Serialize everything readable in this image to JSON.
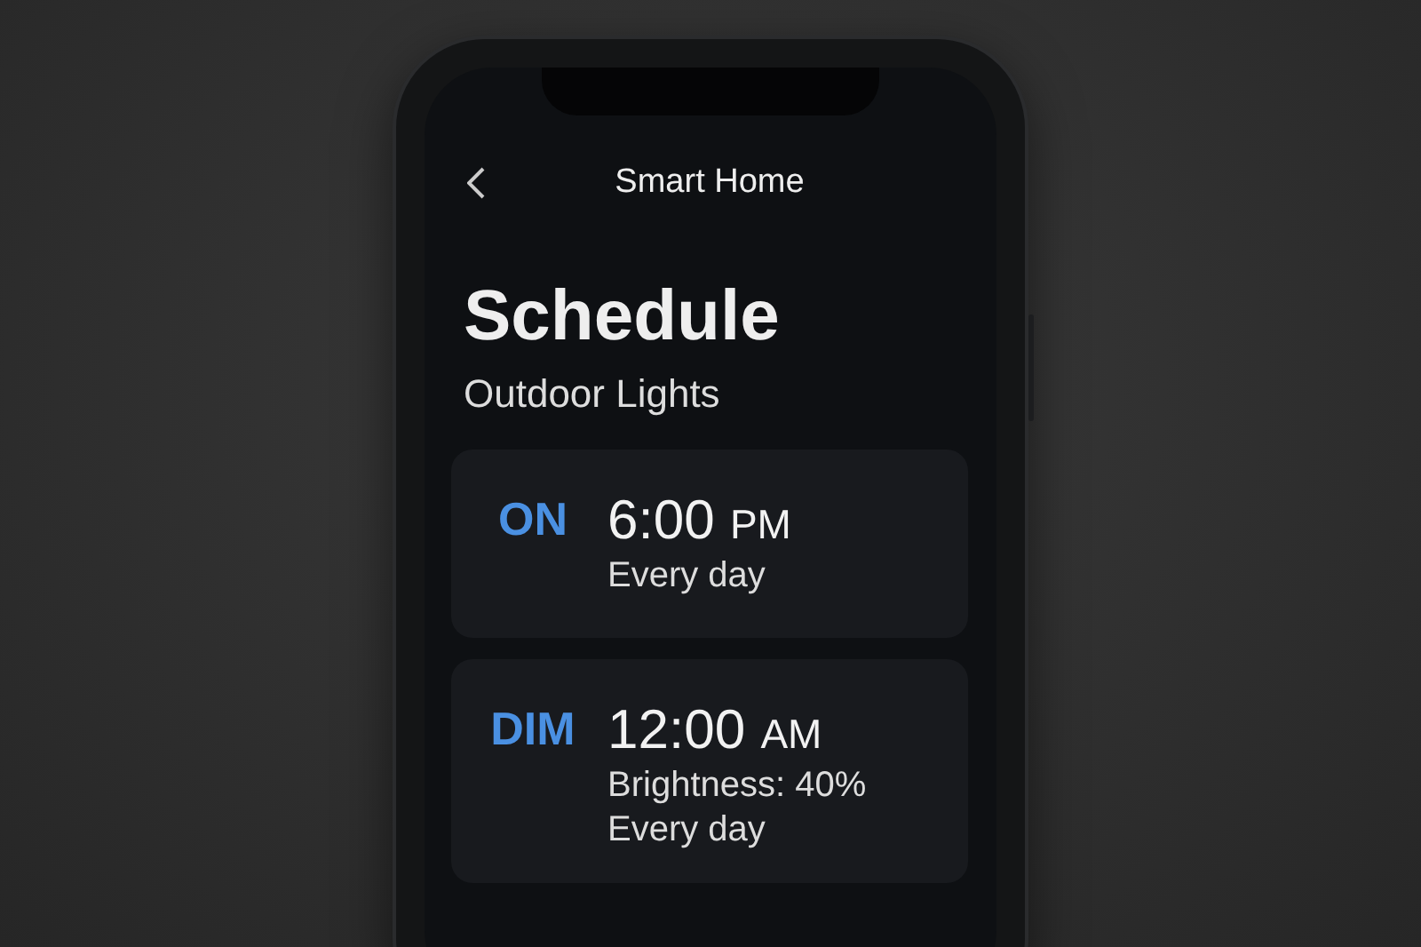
{
  "header": {
    "title": "Smart Home"
  },
  "heading": "Schedule",
  "subtitle": "Outdoor Lights",
  "schedules": [
    {
      "action": "ON",
      "time": "6:00",
      "period": "PM",
      "details": [
        "Every day"
      ]
    },
    {
      "action": "DIM",
      "time": "12:00",
      "period": "AM",
      "details": [
        "Brightness: 40%",
        "Every day"
      ]
    }
  ]
}
